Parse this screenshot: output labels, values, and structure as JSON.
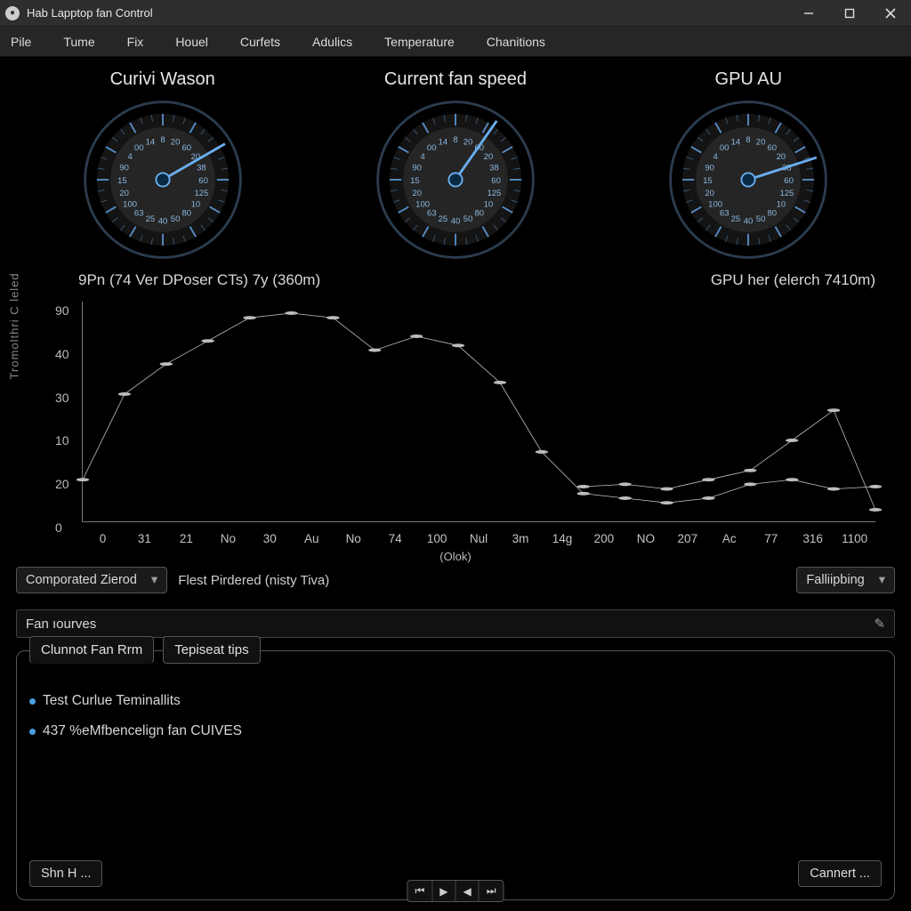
{
  "window": {
    "title": "Hab Lapptop fan Control",
    "icon_glyph": "●"
  },
  "menu": [
    "Pile",
    "Tume",
    "Fix",
    "Houel",
    "Curfets",
    "Adulics",
    "Temperature",
    "Chanitions"
  ],
  "gauges": [
    {
      "label": "Curivi Wason",
      "needle_deg": 60
    },
    {
      "label": "Current fan speed",
      "needle_deg": 35
    },
    {
      "label": "GPU AU",
      "needle_deg": 72
    }
  ],
  "gauge_ticks": [
    "8",
    "20",
    "60",
    "20",
    "38",
    "60",
    "125",
    "10",
    "80",
    "50",
    "40",
    "25",
    "63",
    "100",
    "20",
    "15",
    "90",
    "4",
    "00",
    "14"
  ],
  "graph": {
    "left_label": "9Pn (74 Ver DPoser CTs) 7y (360m)",
    "right_label": "GPU her (elerch 7410m)",
    "ylabel": "Tromolthri C leled",
    "yticks": [
      "90",
      "40",
      "30",
      "10",
      "20",
      "0"
    ],
    "xticks": [
      "0",
      "31",
      "21",
      "No",
      "30",
      "Au",
      "No",
      "74",
      "100",
      "Nul",
      "3m",
      "14g",
      "200",
      "NO",
      "207",
      "Ac",
      "77",
      "316",
      "1100"
    ],
    "xunit": "(Olok)"
  },
  "chart_data": {
    "type": "line",
    "title": "9Pn (74 Ver DPoser CTs) 7y (360m)",
    "ylabel": "Tromolthri C leled",
    "xlabel": "(Olok)",
    "xticks_raw": [
      "0",
      "31",
      "21",
      "No",
      "30",
      "Au",
      "No",
      "74",
      "100",
      "Nul",
      "3m",
      "14g",
      "200",
      "NO",
      "207",
      "Ac",
      "77",
      "316",
      "1100"
    ],
    "ylim": [
      0,
      95
    ],
    "x": [
      0,
      1,
      2,
      3,
      4,
      5,
      6,
      7,
      8,
      9,
      10,
      11,
      12,
      13,
      14,
      15,
      16,
      17,
      18,
      19
    ],
    "values": [
      18,
      55,
      68,
      78,
      88,
      90,
      88,
      74,
      80,
      76,
      60,
      30,
      12,
      10,
      8,
      10,
      16,
      18,
      14,
      15
    ],
    "secondary": {
      "name": "GPU her (elerch 7410m)",
      "x": [
        12,
        13,
        14,
        15,
        16,
        17,
        18,
        19
      ],
      "values": [
        15,
        16,
        14,
        18,
        22,
        35,
        48,
        5
      ]
    }
  },
  "controls": {
    "mode_dropdown": "Comporated Zierod",
    "status_text": "Flest Pirdered (nisty Tiva)",
    "right_dropdown": "Falliipbing"
  },
  "panel_header": "Fan ıourves",
  "tabs": [
    {
      "label": "Clunnot Fan Rrm",
      "active": true
    },
    {
      "label": "Tepiseat tips",
      "active": false
    }
  ],
  "bullets": [
    "Test Curlue Teminallits",
    "437 %eMfbencelign fan CUIVES"
  ],
  "buttons": {
    "left": "Shn H ...",
    "right": "Cannert ..."
  },
  "playback": [
    "⏮",
    "▶",
    "◀",
    "⏭"
  ]
}
